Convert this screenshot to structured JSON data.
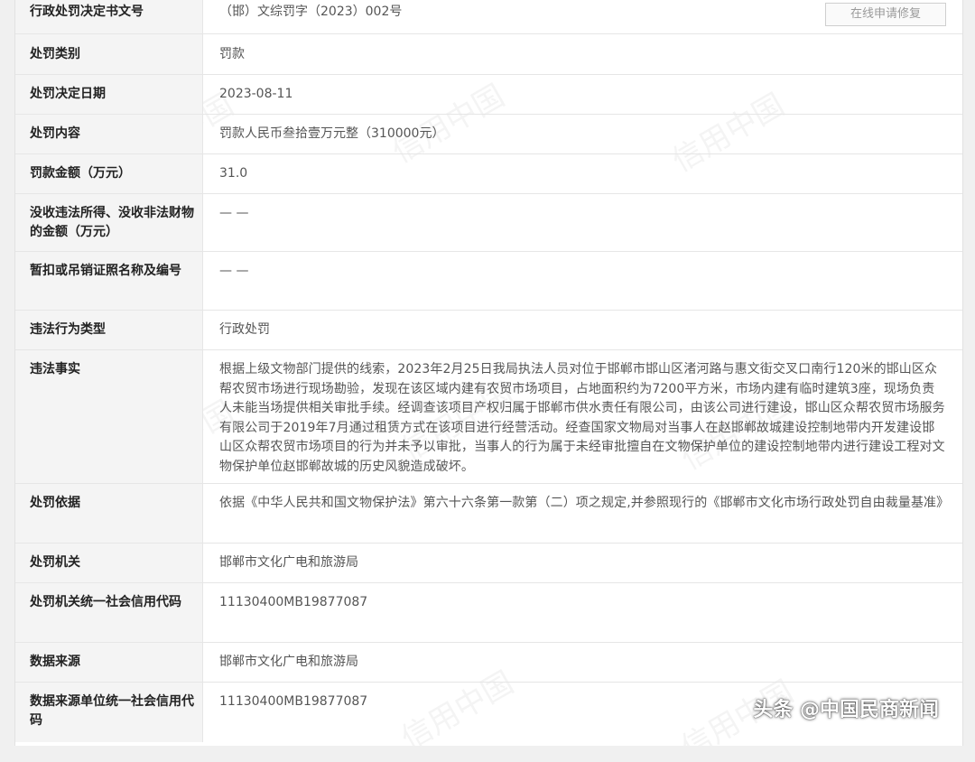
{
  "rows": [
    {
      "label": "行政处罚决定书文号",
      "value": "（邯）文综罚字（2023）002号"
    },
    {
      "label": "处罚类别",
      "value": "罚款"
    },
    {
      "label": "处罚决定日期",
      "value": "2023-08-11"
    },
    {
      "label": "处罚内容",
      "value": "罚款人民币叁拾壹万元整（310000元）"
    },
    {
      "label": "罚款金额（万元）",
      "value": "31.0"
    },
    {
      "label": "没收违法所得、没收非法财物的金额（万元）",
      "value": "— —"
    },
    {
      "label": "暂扣或吊销证照名称及编号",
      "value": "— —"
    },
    {
      "label": "违法行为类型",
      "value": "行政处罚"
    },
    {
      "label": "违法事实",
      "value": "根据上级文物部门提供的线索，2023年2月25日我局执法人员对位于邯郸市邯山区渚河路与惠文街交叉口南行120米的邯山区众帮农贸市场进行现场勘验，发现在该区域内建有农贸市场项目，占地面积约为7200平方米，市场内建有临时建筑3座，现场负责人未能当场提供相关审批手续。经调查该项目产权归属于邯郸市供水责任有限公司，由该公司进行建设，邯山区众帮农贸市场服务有限公司于2019年7月通过租赁方式在该项目进行经营活动。经查国家文物局对当事人在赵邯郸故城建设控制地带内开发建设邯山区众帮农贸市场项目的行为并未予以审批，当事人的行为属于未经审批擅自在文物保护单位的建设控制地带内进行建设工程对文物保护单位赵邯郸故城的历史风貌造成破坏。"
    },
    {
      "label": "处罚依据",
      "value": "依据《中华人民共和国文物保护法》第六十六条第一款第（二）项之规定,并参照现行的《邯郸市文化市场行政处罚自由裁量基准》"
    },
    {
      "label": "处罚机关",
      "value": "邯郸市文化广电和旅游局"
    },
    {
      "label": "处罚机关统一社会信用代码",
      "value": "11130400MB19877087"
    },
    {
      "label": "数据来源",
      "value": "邯郸市文化广电和旅游局"
    },
    {
      "label": "数据来源单位统一社会信用代码",
      "value": "11130400MB19877087"
    }
  ],
  "repair_button": "在线申请修复",
  "watermark_text": "信用中国",
  "credit_text": "头条 @中国民商新闻",
  "colors": {
    "label_bg": "#f4f4f4",
    "border": "#e6e6e6",
    "label_text": "#222222",
    "value_text": "#555555"
  }
}
